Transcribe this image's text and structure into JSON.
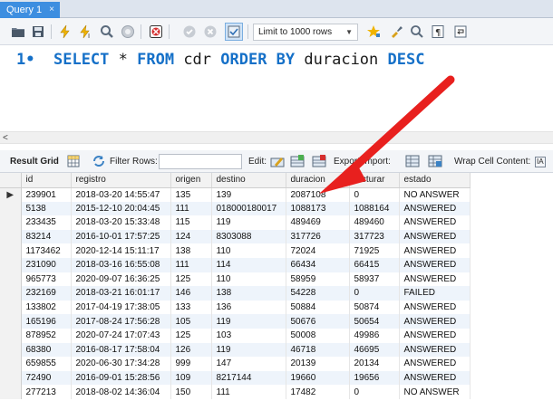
{
  "tab": {
    "title": "Query 1",
    "close": "×"
  },
  "toolbar": {
    "limit_label": "Limit to 1000 rows",
    "icons": [
      "folder-icon",
      "save-icon",
      "lightning-icon",
      "lightning-cursor-icon",
      "magnifier-icon",
      "stop-icon",
      "cancel-icon",
      "commit-icon",
      "rollback-icon",
      "toggle-icon",
      "beautify-star-icon",
      "brush-icon",
      "search-icon",
      "paragraph-icon",
      "wrap-icon"
    ]
  },
  "editor": {
    "line_number": "1",
    "bullet": "•",
    "tokens": [
      {
        "t": "SELECT",
        "kw": true
      },
      {
        "t": " * ",
        "kw": false
      },
      {
        "t": "FROM",
        "kw": true
      },
      {
        "t": " cdr ",
        "kw": false
      },
      {
        "t": "ORDER BY",
        "kw": true
      },
      {
        "t": " duracion ",
        "kw": false
      },
      {
        "t": "DESC",
        "kw": true
      }
    ]
  },
  "scrollbar": {
    "left_arrow": "<"
  },
  "resultbar": {
    "result_grid": "Result Grid",
    "filter_rows": "Filter Rows:",
    "edit": "Edit:",
    "export_import": "Export/Import:",
    "wrap_cell": "Wrap Cell Content:",
    "wrap_icon_text": "IA"
  },
  "table": {
    "columns": [
      "id",
      "registro",
      "origen",
      "destino",
      "duracion",
      "facturar",
      "estado"
    ],
    "current_row_marker": "▶",
    "rows": [
      [
        "239901",
        "2018-03-20 14:55:47",
        "135",
        "139",
        "2087108",
        "0",
        "NO ANSWER"
      ],
      [
        "5138",
        "2015-12-10 20:04:45",
        "111",
        "018000180017",
        "1088173",
        "1088164",
        "ANSWERED"
      ],
      [
        "233435",
        "2018-03-20 15:33:48",
        "115",
        "119",
        "489469",
        "489460",
        "ANSWERED"
      ],
      [
        "83214",
        "2016-10-01 17:57:25",
        "124",
        "8303088",
        "317726",
        "317723",
        "ANSWERED"
      ],
      [
        "1173462",
        "2020-12-14 15:11:17",
        "138",
        "110",
        "72024",
        "71925",
        "ANSWERED"
      ],
      [
        "231090",
        "2018-03-16 16:55:08",
        "111",
        "114",
        "66434",
        "66415",
        "ANSWERED"
      ],
      [
        "965773",
        "2020-09-07 16:36:25",
        "125",
        "110",
        "58959",
        "58937",
        "ANSWERED"
      ],
      [
        "232169",
        "2018-03-21 16:01:17",
        "146",
        "138",
        "54228",
        "0",
        "FAILED"
      ],
      [
        "133802",
        "2017-04-19 17:38:05",
        "133",
        "136",
        "50884",
        "50874",
        "ANSWERED"
      ],
      [
        "165196",
        "2017-08-24 17:56:28",
        "105",
        "119",
        "50676",
        "50654",
        "ANSWERED"
      ],
      [
        "878952",
        "2020-07-24 17:07:43",
        "125",
        "103",
        "50008",
        "49986",
        "ANSWERED"
      ],
      [
        "68380",
        "2016-08-17 17:58:04",
        "126",
        "119",
        "46718",
        "46695",
        "ANSWERED"
      ],
      [
        "659855",
        "2020-06-30 17:34:28",
        "999",
        "147",
        "20139",
        "20134",
        "ANSWERED"
      ],
      [
        "72490",
        "2016-09-01 15:28:56",
        "109",
        "8217144",
        "19660",
        "19656",
        "ANSWERED"
      ],
      [
        "277213",
        "2018-08-02 14:36:04",
        "150",
        "111",
        "17482",
        "0",
        "NO ANSWER"
      ]
    ]
  },
  "annotation": {
    "arrow_color": "#e8201e"
  }
}
